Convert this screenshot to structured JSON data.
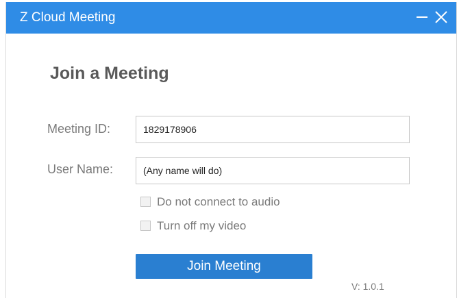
{
  "window": {
    "title": "Z Cloud Meeting",
    "controls": {
      "minimize_icon": "minimize-icon",
      "close_icon": "close-icon"
    }
  },
  "form": {
    "heading": "Join a Meeting",
    "meeting_id": {
      "label": "Meeting ID:",
      "value": "1829178906"
    },
    "user_name": {
      "label": "User Name:",
      "value": "(Any name will do)"
    },
    "options": [
      {
        "label": "Do not connect to audio",
        "checked": false
      },
      {
        "label": "Turn off my video",
        "checked": false
      }
    ],
    "join_label": "Join Meeting"
  },
  "footer": {
    "version": "V:  1.0.1"
  },
  "colors": {
    "titlebar": "#2f8ce6",
    "button": "#2a7fd1",
    "label_text": "#7a7a7a",
    "heading_text": "#595959"
  }
}
